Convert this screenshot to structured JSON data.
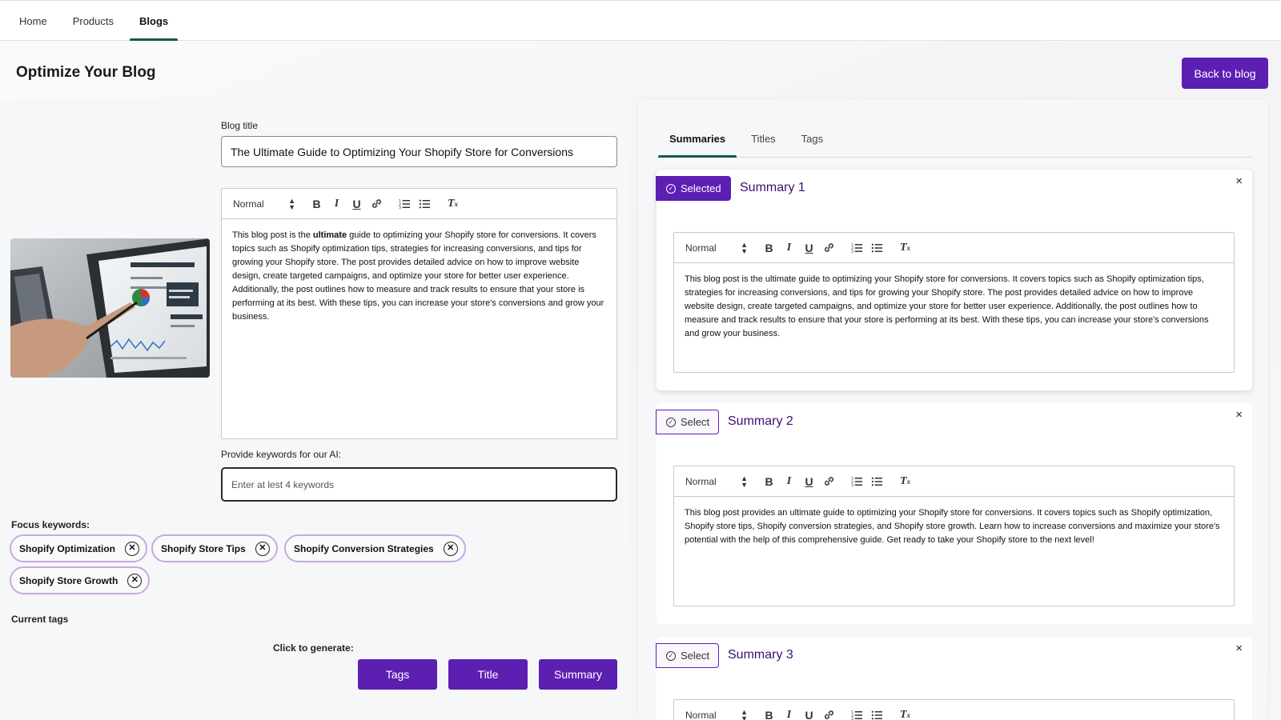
{
  "nav": {
    "items": [
      {
        "label": "Home"
      },
      {
        "label": "Products"
      },
      {
        "label": "Blogs"
      }
    ]
  },
  "page": {
    "title": "Optimize Your Blog",
    "back_label": "Back to blog"
  },
  "left": {
    "blog_title_label": "Blog title",
    "blog_title_value": "The Ultimate Guide to Optimizing Your Shopify Store for Conversions",
    "editor": {
      "format": "Normal",
      "body_before": "This blog post is the ",
      "body_bold": "ultimate",
      "body_after": " guide to optimizing your Shopify store for conversions. It covers topics such as Shopify optimization tips, strategies for increasing conversions, and tips for growing your Shopify store. The post provides detailed advice on how to improve website design, create targeted campaigns, and optimize your store for better user experience. Additionally, the post outlines how to measure and track results to ensure that your store is performing at its best. With these tips, you can increase your store's conversions and grow your business."
    },
    "keywords_label": "Provide keywords for our AI:",
    "keywords_placeholder": "Enter at lest 4 keywords",
    "focus_label": "Focus keywords:",
    "focus_keywords": [
      "Shopify Optimization",
      "Shopify Store Tips",
      "Shopify Conversion Strategies",
      "Shopify Store Growth"
    ],
    "current_tags_label": "Current tags",
    "generate_label": "Click to generate:",
    "generate_buttons": {
      "tags": "Tags",
      "title": "Title",
      "summary": "Summary"
    }
  },
  "right": {
    "tabs": [
      "Summaries",
      "Titles",
      "Tags"
    ],
    "summaries": [
      {
        "select_label": "Selected",
        "title": "Summary 1",
        "format": "Normal",
        "body": "This blog post is the ultimate guide to optimizing your Shopify store for conversions. It covers topics such as Shopify optimization tips, strategies for increasing conversions, and tips for growing your Shopify store. The post provides detailed advice on how to improve website design, create targeted campaigns, and optimize your store for better user experience. Additionally, the post outlines how to measure and track results to ensure that your store is performing at its best. With these tips, you can increase your store's conversions and grow your business."
      },
      {
        "select_label": "Select",
        "title": "Summary 2",
        "format": "Normal",
        "body": "This blog post provides an ultimate guide to optimizing your Shopify store for conversions. It covers topics such as Shopify optimization, Shopify store tips, Shopify conversion strategies, and Shopify store growth. Learn how to increase conversions and maximize your store's potential with the help of this comprehensive guide. Get ready to take your Shopify store to the next level!"
      },
      {
        "select_label": "Select",
        "title": "Summary 3",
        "format": "Normal"
      }
    ],
    "close_glyph": "×"
  },
  "colors": {
    "accent": "#5d1eb2",
    "tab_underline": "#0c5b4a",
    "chip_border": "#c6a8e6",
    "summary_title": "#3d0f70"
  }
}
